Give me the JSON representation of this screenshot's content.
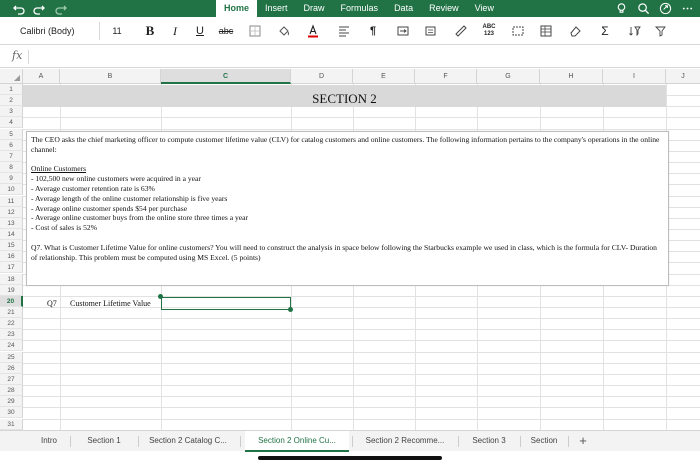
{
  "ribbon": {
    "tabs": [
      {
        "label": "Home",
        "active": true
      },
      {
        "label": "Insert",
        "active": false
      },
      {
        "label": "Draw",
        "active": false
      },
      {
        "label": "Formulas",
        "active": false
      },
      {
        "label": "Data",
        "active": false
      },
      {
        "label": "Review",
        "active": false
      },
      {
        "label": "View",
        "active": false
      }
    ],
    "accent_color": "#217346"
  },
  "toolbar": {
    "font_name": "Calibri (Body)",
    "font_size": "11",
    "bold": "B",
    "italic": "I",
    "underline": "U",
    "strike": "abc",
    "spelling": "ABC 123",
    "sum": "Σ"
  },
  "formula_bar": {
    "fx": "fx",
    "value": ""
  },
  "grid": {
    "columns": [
      "A",
      "B",
      "C",
      "D",
      "E",
      "F",
      "G",
      "H",
      "I",
      "J"
    ],
    "selected_column": "C",
    "rows": [
      "1",
      "2",
      "3",
      "4",
      "5",
      "6",
      "7",
      "8",
      "9",
      "10",
      "11",
      "12",
      "13",
      "14",
      "15",
      "16",
      "17",
      "18",
      "19",
      "20",
      "21",
      "22",
      "23",
      "24",
      "25",
      "26",
      "27",
      "28",
      "29",
      "30",
      "31"
    ],
    "selected_row": "20"
  },
  "sheet": {
    "section_title": "SECTION 2",
    "intro": "The CEO asks the chief marketing officer to compute customer lifetime value (CLV) for catalog customers and online customers. The following information pertains to the company's operations in the online channel:",
    "heading": "Online Customers",
    "bullets": [
      "- 102,500 new online customers were acquired in a year",
      "- Average customer retention rate is 63%",
      "- Average length of the online customer relationship is five years",
      "- Average online customer spends $54 per purchase",
      "- Average online customer buys from the online store three times a year",
      "- Cost of sales is 52%"
    ],
    "question": "Q7. What is Customer Lifetime Value for online customers? You will need to construct the analysis in space below following the Starbucks example we used in class, which is the formula for CLV- Duration of relationship. This problem must be computed using MS Excel. (5 points)",
    "q_label": "Q7",
    "q_title": "Customer Lifetime Value"
  },
  "sheet_tabs": [
    {
      "label": "Intro",
      "active": false
    },
    {
      "label": "Section 1",
      "active": false
    },
    {
      "label": "Section 2 Catalog C...",
      "active": false
    },
    {
      "label": "Section 2 Online Cu...",
      "active": true
    },
    {
      "label": "Section 2 Recomme...",
      "active": false
    },
    {
      "label": "Section 3",
      "active": false
    },
    {
      "label": "Section",
      "active": false
    }
  ],
  "add_sheet": "+"
}
